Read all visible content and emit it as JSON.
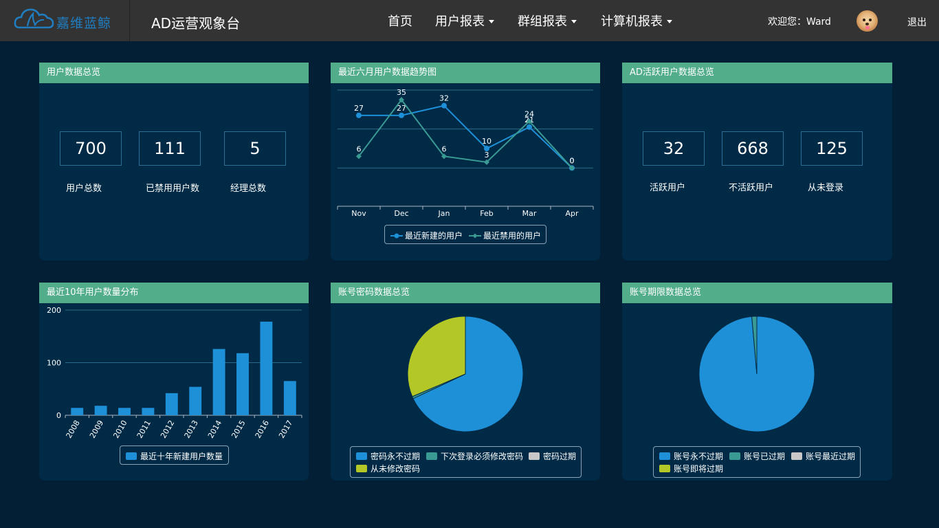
{
  "header": {
    "logo_text": "嘉维蓝鲸",
    "title": "AD运营观象台",
    "nav": [
      {
        "label": "首页",
        "dropdown": false
      },
      {
        "label": "用户报表",
        "dropdown": true
      },
      {
        "label": "群组报表",
        "dropdown": true
      },
      {
        "label": "计算机报表",
        "dropdown": true
      }
    ],
    "welcome": "欢迎您：Ward",
    "logout": "退出",
    "avatar_icon": "dog-avatar-icon"
  },
  "colors": {
    "background": "#021f35",
    "panel": "#012a46",
    "panel_header": "#52ad8b",
    "topbar": "#333333",
    "blue": "#1e90d8",
    "teal": "#3a9a94",
    "gray": "#c8c8c8",
    "lime": "#b3c826"
  },
  "user_overview": {
    "title": "用户数据总览",
    "stats": [
      {
        "value": "700",
        "label": "用户总数"
      },
      {
        "value": "111",
        "label": "已禁用用户数"
      },
      {
        "value": "5",
        "label": "经理总数"
      }
    ]
  },
  "active_overview": {
    "title": "AD活跃用户数据总览",
    "stats": [
      {
        "value": "32",
        "label": "活跃用户"
      },
      {
        "value": "668",
        "label": "不活跃用户"
      },
      {
        "value": "125",
        "label": "从未登录"
      }
    ]
  },
  "trend_panel": {
    "title": "最近六月用户数据趋势图"
  },
  "yearly_panel": {
    "title": "最近10年用户数量分布"
  },
  "password_panel": {
    "title": "账号密码数据总览"
  },
  "expiry_panel": {
    "title": "账号期限数据总览"
  },
  "chart_data": [
    {
      "type": "line",
      "title": "最近六月用户数据趋势图",
      "categories": [
        "Nov",
        "Dec",
        "Jan",
        "Feb",
        "Mar",
        "Apr"
      ],
      "series": [
        {
          "name": "最近新建的用户",
          "values": [
            27,
            27,
            32,
            10,
            21,
            0
          ],
          "color": "#1e90d8"
        },
        {
          "name": "最近禁用的用户",
          "values": [
            6,
            35,
            6,
            3,
            24,
            0
          ],
          "color": "#3a9a94"
        }
      ],
      "ylim": [
        -20,
        40
      ],
      "grid": true,
      "legend": "bottom"
    },
    {
      "type": "bar",
      "title": "最近10年用户数量分布",
      "categories": [
        "2008",
        "2009",
        "2010",
        "2011",
        "2012",
        "2013",
        "2014",
        "2015",
        "2016",
        "2017"
      ],
      "series": [
        {
          "name": "最近十年新建用户数量",
          "values": [
            14,
            18,
            14,
            14,
            42,
            54,
            126,
            118,
            178,
            65
          ],
          "color": "#1e90d8"
        }
      ],
      "yticks": [
        0,
        100,
        200
      ],
      "ylim": [
        0,
        200
      ],
      "grid": true,
      "legend": "bottom"
    },
    {
      "type": "pie",
      "title": "账号密码数据总览",
      "slices": [
        {
          "label": "密码永不过期",
          "value": 68,
          "color": "#1e90d8"
        },
        {
          "label": "下次登录必须修改密码",
          "value": 0.6,
          "color": "#3a9a94"
        },
        {
          "label": "密码过期",
          "value": 0,
          "color": "#c8c8c8"
        },
        {
          "label": "从未修改密码",
          "value": 31.4,
          "color": "#b3c826"
        }
      ],
      "legend": "bottom"
    },
    {
      "type": "pie",
      "title": "账号期限数据总览",
      "slices": [
        {
          "label": "账号永不过期",
          "value": 98.6,
          "color": "#1e90d8"
        },
        {
          "label": "账号已过期",
          "value": 1.4,
          "color": "#3a9a94"
        },
        {
          "label": "账号最近过期",
          "value": 0,
          "color": "#c8c8c8"
        },
        {
          "label": "账号即将过期",
          "value": 0,
          "color": "#b3c826"
        }
      ],
      "legend": "bottom"
    }
  ]
}
